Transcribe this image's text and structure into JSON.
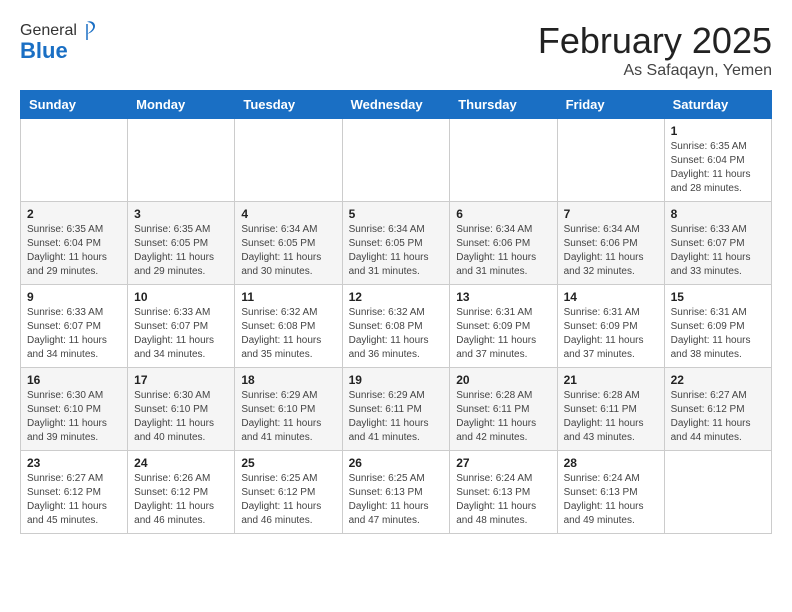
{
  "logo": {
    "general": "General",
    "blue": "Blue"
  },
  "header": {
    "month": "February 2025",
    "location": "As Safaqayn, Yemen"
  },
  "weekdays": [
    "Sunday",
    "Monday",
    "Tuesday",
    "Wednesday",
    "Thursday",
    "Friday",
    "Saturday"
  ],
  "weeks": [
    [
      {
        "day": "",
        "info": ""
      },
      {
        "day": "",
        "info": ""
      },
      {
        "day": "",
        "info": ""
      },
      {
        "day": "",
        "info": ""
      },
      {
        "day": "",
        "info": ""
      },
      {
        "day": "",
        "info": ""
      },
      {
        "day": "1",
        "info": "Sunrise: 6:35 AM\nSunset: 6:04 PM\nDaylight: 11 hours and 28 minutes."
      }
    ],
    [
      {
        "day": "2",
        "info": "Sunrise: 6:35 AM\nSunset: 6:04 PM\nDaylight: 11 hours and 29 minutes."
      },
      {
        "day": "3",
        "info": "Sunrise: 6:35 AM\nSunset: 6:05 PM\nDaylight: 11 hours and 29 minutes."
      },
      {
        "day": "4",
        "info": "Sunrise: 6:34 AM\nSunset: 6:05 PM\nDaylight: 11 hours and 30 minutes."
      },
      {
        "day": "5",
        "info": "Sunrise: 6:34 AM\nSunset: 6:05 PM\nDaylight: 11 hours and 31 minutes."
      },
      {
        "day": "6",
        "info": "Sunrise: 6:34 AM\nSunset: 6:06 PM\nDaylight: 11 hours and 31 minutes."
      },
      {
        "day": "7",
        "info": "Sunrise: 6:34 AM\nSunset: 6:06 PM\nDaylight: 11 hours and 32 minutes."
      },
      {
        "day": "8",
        "info": "Sunrise: 6:33 AM\nSunset: 6:07 PM\nDaylight: 11 hours and 33 minutes."
      }
    ],
    [
      {
        "day": "9",
        "info": "Sunrise: 6:33 AM\nSunset: 6:07 PM\nDaylight: 11 hours and 34 minutes."
      },
      {
        "day": "10",
        "info": "Sunrise: 6:33 AM\nSunset: 6:07 PM\nDaylight: 11 hours and 34 minutes."
      },
      {
        "day": "11",
        "info": "Sunrise: 6:32 AM\nSunset: 6:08 PM\nDaylight: 11 hours and 35 minutes."
      },
      {
        "day": "12",
        "info": "Sunrise: 6:32 AM\nSunset: 6:08 PM\nDaylight: 11 hours and 36 minutes."
      },
      {
        "day": "13",
        "info": "Sunrise: 6:31 AM\nSunset: 6:09 PM\nDaylight: 11 hours and 37 minutes."
      },
      {
        "day": "14",
        "info": "Sunrise: 6:31 AM\nSunset: 6:09 PM\nDaylight: 11 hours and 37 minutes."
      },
      {
        "day": "15",
        "info": "Sunrise: 6:31 AM\nSunset: 6:09 PM\nDaylight: 11 hours and 38 minutes."
      }
    ],
    [
      {
        "day": "16",
        "info": "Sunrise: 6:30 AM\nSunset: 6:10 PM\nDaylight: 11 hours and 39 minutes."
      },
      {
        "day": "17",
        "info": "Sunrise: 6:30 AM\nSunset: 6:10 PM\nDaylight: 11 hours and 40 minutes."
      },
      {
        "day": "18",
        "info": "Sunrise: 6:29 AM\nSunset: 6:10 PM\nDaylight: 11 hours and 41 minutes."
      },
      {
        "day": "19",
        "info": "Sunrise: 6:29 AM\nSunset: 6:11 PM\nDaylight: 11 hours and 41 minutes."
      },
      {
        "day": "20",
        "info": "Sunrise: 6:28 AM\nSunset: 6:11 PM\nDaylight: 11 hours and 42 minutes."
      },
      {
        "day": "21",
        "info": "Sunrise: 6:28 AM\nSunset: 6:11 PM\nDaylight: 11 hours and 43 minutes."
      },
      {
        "day": "22",
        "info": "Sunrise: 6:27 AM\nSunset: 6:12 PM\nDaylight: 11 hours and 44 minutes."
      }
    ],
    [
      {
        "day": "23",
        "info": "Sunrise: 6:27 AM\nSunset: 6:12 PM\nDaylight: 11 hours and 45 minutes."
      },
      {
        "day": "24",
        "info": "Sunrise: 6:26 AM\nSunset: 6:12 PM\nDaylight: 11 hours and 46 minutes."
      },
      {
        "day": "25",
        "info": "Sunrise: 6:25 AM\nSunset: 6:12 PM\nDaylight: 11 hours and 46 minutes."
      },
      {
        "day": "26",
        "info": "Sunrise: 6:25 AM\nSunset: 6:13 PM\nDaylight: 11 hours and 47 minutes."
      },
      {
        "day": "27",
        "info": "Sunrise: 6:24 AM\nSunset: 6:13 PM\nDaylight: 11 hours and 48 minutes."
      },
      {
        "day": "28",
        "info": "Sunrise: 6:24 AM\nSunset: 6:13 PM\nDaylight: 11 hours and 49 minutes."
      },
      {
        "day": "",
        "info": ""
      }
    ]
  ]
}
